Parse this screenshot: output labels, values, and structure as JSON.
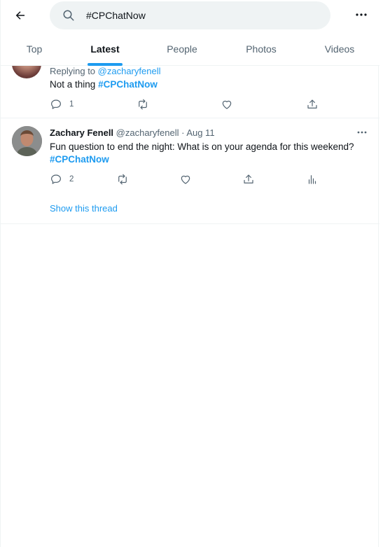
{
  "header": {
    "search_value": "#CPChatNow"
  },
  "tabs": [
    {
      "label": "Top",
      "active": false
    },
    {
      "label": "Latest",
      "active": true
    },
    {
      "label": "People",
      "active": false
    },
    {
      "label": "Photos",
      "active": false
    },
    {
      "label": "Videos",
      "active": false
    }
  ],
  "tweets": [
    {
      "replying_prefix": "Replying to",
      "replying_to": "@zacharyfenell",
      "text": "Not a thing",
      "hashtag": "#CPChatNow",
      "reply_count": "1"
    },
    {
      "name": "Zachary Fenell",
      "handle": "@zacharyfenell",
      "date": "· Aug 11",
      "text": "Fun question to end the night: What is on your agenda for this weekend?",
      "hashtag": "#CPChatNow",
      "reply_count": "2",
      "show_thread": "Show this thread"
    }
  ],
  "colors": {
    "accent": "#1d9bf0",
    "text_primary": "#0f1419",
    "text_secondary": "#536471",
    "search_bg": "#eff3f4"
  },
  "icons": [
    "back-arrow-icon",
    "search-icon",
    "more-icon",
    "reply-icon",
    "retweet-icon",
    "like-icon",
    "share-icon",
    "analytics-icon"
  ]
}
